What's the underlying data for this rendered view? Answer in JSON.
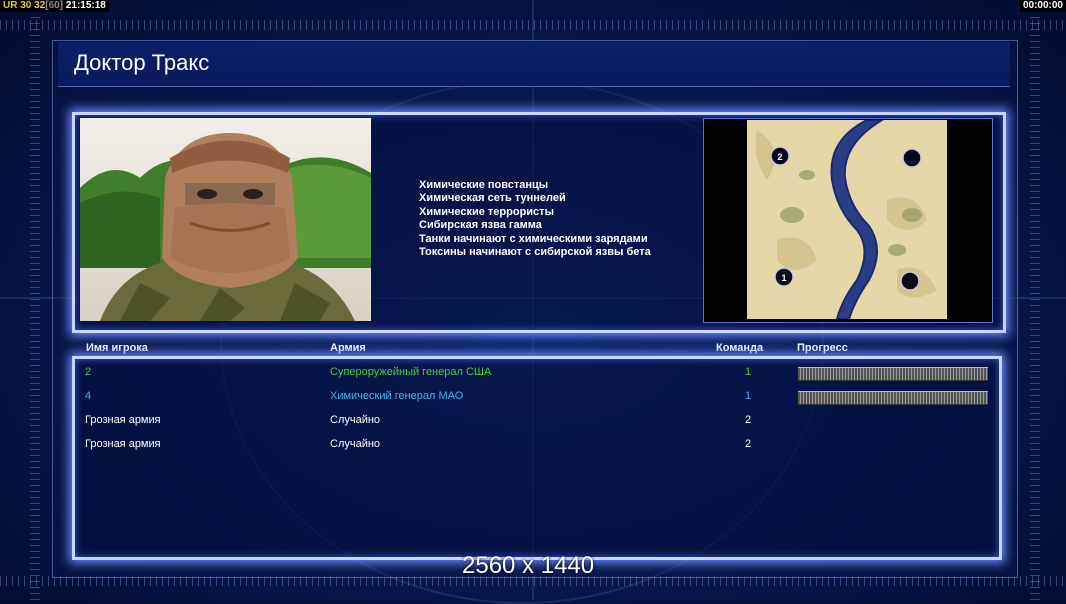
{
  "hud": {
    "prefix": "UR",
    "val_a": "30",
    "val_b": "32",
    "val_c": "[60]",
    "time": "21:15:18",
    "timer": "00:00:00"
  },
  "title": "Доктор Тракс",
  "general_perks": [
    "Химические повстанцы",
    "Химическая сеть туннелей",
    "Химические террористы",
    "Сибирская язва гамма",
    "Танки начинают с химическими зарядами",
    "Токсины начинают с сибирской язвы бета"
  ],
  "map": {
    "start_markers": [
      "2",
      "",
      "1",
      ""
    ]
  },
  "table": {
    "headers": {
      "player": "Имя игрока",
      "army": "Армия",
      "team": "Команда",
      "progress": "Прогресс"
    },
    "rows": [
      {
        "player": "2",
        "army": "Супероружейный генерал США",
        "team": "1",
        "color": "#3fd23f",
        "has_progress": true,
        "progress": 1.0
      },
      {
        "player": "4",
        "army": "Химический генерал МАО",
        "team": "1",
        "color": "#3fb8e8",
        "has_progress": true,
        "progress": 1.0
      },
      {
        "player": "Грозная армия",
        "army": "Случайно",
        "team": "2",
        "color": "#ffffff",
        "has_progress": false
      },
      {
        "player": "Грозная армия",
        "army": "Случайно",
        "team": "2",
        "color": "#ffffff",
        "has_progress": false
      }
    ]
  },
  "resolution_label": "2560 x 1440",
  "colors": {
    "panel_border": "#c9d6ff",
    "panel_glow": "#6f8cff",
    "background": "#081a52"
  }
}
